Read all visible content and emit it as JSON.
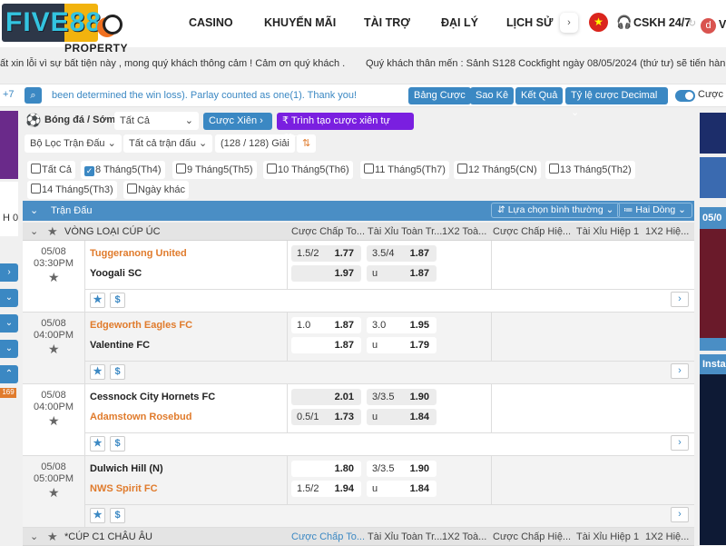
{
  "header": {
    "logo_text": "FIVE88",
    "logo_sub": "PROPERTY",
    "nav": [
      "CASINO",
      "KHUYẾN MÃI",
      "TÀI TRỢ",
      "ĐẠI LÝ",
      "LỊCH SỬ"
    ],
    "support": "CSKH 24/7",
    "user_initial": "d",
    "user_text": "V"
  },
  "marquee": {
    "left": "ất xin lỗi vì sự bất tiện này , mong quý khách thông cảm ! Cảm ơn quý khách .",
    "right": "Quý khách thân mến : Sảnh S128 Cockfight ngày 08/05/2024 (thứ tư) sẽ tiến hành bảo trì"
  },
  "toolbar": {
    "count": "+7",
    "notice": "been determined the win loss). Parlay counted as one(1). Thank you!",
    "buttons": [
      "Bảng Cược",
      "Sao Kê",
      "Kết Quả"
    ],
    "odds_type": "Tỷ lệ cược Decimal",
    "toggle_label": "Cược N"
  },
  "filters": {
    "sport": "Bóng đá / Sớm",
    "market": "Tất Cả",
    "parlay": "Cược Xiên",
    "auto_parlay": "Trình tạo cược xiên tự động",
    "match_filter": "Bộ Lọc Trận Đấu",
    "all_matches": "Tất cả trận đấu",
    "league_count": "(128 / 128) Giải",
    "dates": [
      {
        "label": "Tất Cả",
        "checked": false
      },
      {
        "label": "8 Tháng5(Th4)",
        "checked": true
      },
      {
        "label": "9 Tháng5(Th5)",
        "checked": false
      },
      {
        "label": "10 Tháng5(Th6)",
        "checked": false
      },
      {
        "label": "11 Tháng5(Th7)",
        "checked": false
      },
      {
        "label": "12 Tháng5(CN)",
        "checked": false
      },
      {
        "label": "13 Tháng5(Th2)",
        "checked": false
      },
      {
        "label": "14 Tháng5(Th3)",
        "checked": false
      },
      {
        "label": "Ngày khác",
        "checked": false
      }
    ]
  },
  "table": {
    "title": "Trận Đấu",
    "sort": "Lựa chọn bình thường",
    "view": "Hai Dòng",
    "columns": [
      "Cược Chấp To...",
      "Tài Xỉu Toàn Tr...",
      "1X2 Toà...",
      "Cược Chấp Hiệ...",
      "Tài Xỉu Hiệp 1",
      "1X2 Hiệ..."
    ],
    "leagues": [
      {
        "name": "VÒNG LOẠI CÚP ÚC",
        "matches": [
          {
            "date": "05/08",
            "time": "03:30PM",
            "home": "Tuggeranong United",
            "away": "Yoogali SC",
            "fav": "home",
            "hdp": [
              {
                "line": "1.5/2",
                "odds": "1.77"
              },
              {
                "line": "",
                "odds": "1.97"
              }
            ],
            "ou": [
              {
                "line": "3.5/4",
                "odds": "1.87"
              },
              {
                "line": "u",
                "odds": "1.87"
              }
            ]
          },
          {
            "date": "05/08",
            "time": "04:00PM",
            "home": "Edgeworth Eagles FC",
            "away": "Valentine FC",
            "fav": "home",
            "hdp": [
              {
                "line": "1.0",
                "odds": "1.87"
              },
              {
                "line": "",
                "odds": "1.87"
              }
            ],
            "ou": [
              {
                "line": "3.0",
                "odds": "1.95"
              },
              {
                "line": "u",
                "odds": "1.79"
              }
            ]
          },
          {
            "date": "05/08",
            "time": "04:00PM",
            "home": "Cessnock City Hornets FC",
            "away": "Adamstown Rosebud",
            "fav": "away",
            "hdp": [
              {
                "line": "",
                "odds": "2.01"
              },
              {
                "line": "0.5/1",
                "odds": "1.73"
              }
            ],
            "ou": [
              {
                "line": "3/3.5",
                "odds": "1.90"
              },
              {
                "line": "u",
                "odds": "1.84"
              }
            ]
          },
          {
            "date": "05/08",
            "time": "05:00PM",
            "home": "Dulwich Hill (N)",
            "away": "NWS Spirit FC",
            "fav": "away",
            "hdp": [
              {
                "line": "",
                "odds": "1.80"
              },
              {
                "line": "1.5/2",
                "odds": "1.94"
              }
            ],
            "ou": [
              {
                "line": "3/3.5",
                "odds": "1.90"
              },
              {
                "line": "u",
                "odds": "1.84"
              }
            ]
          }
        ]
      },
      {
        "name": "*CÚP C1 CHÂU ÂU"
      }
    ]
  },
  "right": {
    "date": "05/0",
    "promo": "Insta"
  },
  "left": {
    "badge": "169",
    "text1": "H 0"
  },
  "colors": {
    "accent": "#3b88c3",
    "favorite": "#e07b2c",
    "parlay_builder": "#7a1fe0"
  }
}
